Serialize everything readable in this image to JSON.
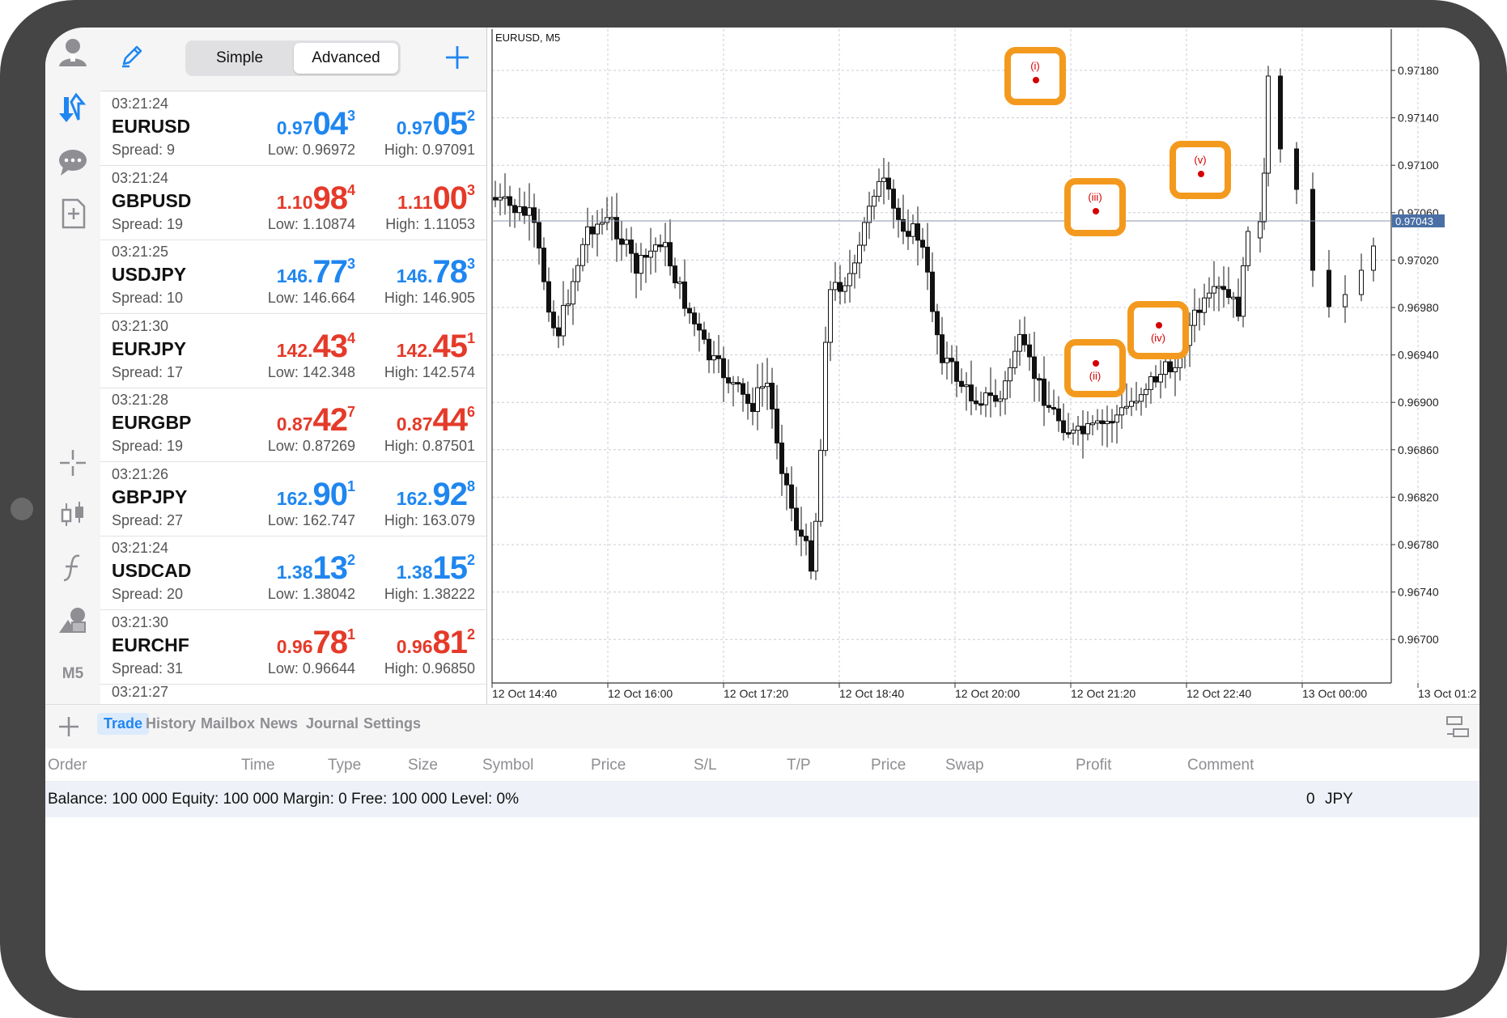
{
  "toolbar": {
    "icons": [
      "account-icon",
      "quotes-icon",
      "chat-icon",
      "new-order-icon",
      "crosshair-icon",
      "chart-type-icon",
      "indicators-icon",
      "objects-icon"
    ],
    "timeframe": "M5"
  },
  "quotes_header": {
    "mode_simple": "Simple",
    "mode_advanced": "Advanced",
    "active_mode": "Advanced"
  },
  "quotes": [
    {
      "time": "03:21:24",
      "symbol": "EURUSD",
      "spread": "Spread: 9",
      "bid": {
        "a": "0.97",
        "b": "04",
        "c": "3"
      },
      "ask": {
        "a": "0.97",
        "b": "05",
        "c": "2"
      },
      "low": "Low: 0.96972",
      "high": "High: 0.97091",
      "color": "#1f86f0"
    },
    {
      "time": "03:21:24",
      "symbol": "GBPUSD",
      "spread": "Spread: 19",
      "bid": {
        "a": "1.10",
        "b": "98",
        "c": "4"
      },
      "ask": {
        "a": "1.11",
        "b": "00",
        "c": "3"
      },
      "low": "Low: 1.10874",
      "high": "High: 1.11053",
      "color": "#e53a2a"
    },
    {
      "time": "03:21:25",
      "symbol": "USDJPY",
      "spread": "Spread: 10",
      "bid": {
        "a": "146.",
        "b": "77",
        "c": "3"
      },
      "ask": {
        "a": "146.",
        "b": "78",
        "c": "3"
      },
      "low": "Low: 146.664",
      "high": "High: 146.905",
      "color": "#1f86f0"
    },
    {
      "time": "03:21:30",
      "symbol": "EURJPY",
      "spread": "Spread: 17",
      "bid": {
        "a": "142.",
        "b": "43",
        "c": "4"
      },
      "ask": {
        "a": "142.",
        "b": "45",
        "c": "1"
      },
      "low": "Low: 142.348",
      "high": "High: 142.574",
      "color": "#e53a2a"
    },
    {
      "time": "03:21:28",
      "symbol": "EURGBP",
      "spread": "Spread: 19",
      "bid": {
        "a": "0.87",
        "b": "42",
        "c": "7"
      },
      "ask": {
        "a": "0.87",
        "b": "44",
        "c": "6"
      },
      "low": "Low: 0.87269",
      "high": "High: 0.87501",
      "color": "#e53a2a"
    },
    {
      "time": "03:21:26",
      "symbol": "GBPJPY",
      "spread": "Spread: 27",
      "bid": {
        "a": "162.",
        "b": "90",
        "c": "1"
      },
      "ask": {
        "a": "162.",
        "b": "92",
        "c": "8"
      },
      "low": "Low: 162.747",
      "high": "High: 163.079",
      "color": "#1f86f0"
    },
    {
      "time": "03:21:24",
      "symbol": "USDCAD",
      "spread": "Spread: 20",
      "bid": {
        "a": "1.38",
        "b": "13",
        "c": "2"
      },
      "ask": {
        "a": "1.38",
        "b": "15",
        "c": "2"
      },
      "low": "Low: 1.38042",
      "high": "High: 1.38222",
      "color": "#1f86f0"
    },
    {
      "time": "03:21:30",
      "symbol": "EURCHF",
      "spread": "Spread: 31",
      "bid": {
        "a": "0.96",
        "b": "78",
        "c": "1"
      },
      "ask": {
        "a": "0.96",
        "b": "81",
        "c": "2"
      },
      "low": "Low: 0.96644",
      "high": "High: 0.96850",
      "color": "#e53a2a"
    }
  ],
  "partial_quote_time": "03:21:27",
  "chart": {
    "symbol_label": "EURUSD, M5",
    "price_ticks": [
      "0.97180",
      "0.97140",
      "0.97100",
      "0.97060",
      "0.97020",
      "0.96980",
      "0.96940",
      "0.96900",
      "0.96860",
      "0.96820",
      "0.96780",
      "0.96740",
      "0.96700"
    ],
    "current_price": "0.97043",
    "time_ticks": [
      "12 Oct 14:40",
      "12 Oct 16:00",
      "12 Oct 17:20",
      "12 Oct 18:40",
      "12 Oct 20:00",
      "12 Oct 21:20",
      "12 Oct 22:40",
      "13 Oct 00:00",
      "13 Oct 01:2"
    ],
    "wave_labels": [
      "(i)",
      "(ii)",
      "(iii)",
      "(iv)",
      "(v)"
    ],
    "highlight_color": "#f39a1e",
    "marker_color": "#d40000"
  },
  "bottom": {
    "tabs": [
      "Trade",
      "History",
      "Mailbox",
      "News",
      "Journal",
      "Settings"
    ],
    "active_tab": "Trade",
    "columns": [
      "Order",
      "Time",
      "Type",
      "Size",
      "Symbol",
      "Price",
      "S/L",
      "T/P",
      "Price",
      "Swap",
      "Profit",
      "Comment"
    ],
    "balance_text": "Balance: 100 000 Equity: 100 000 Margin: 0 Free: 100 000 Level: 0%",
    "profit": "0",
    "currency": "JPY"
  }
}
